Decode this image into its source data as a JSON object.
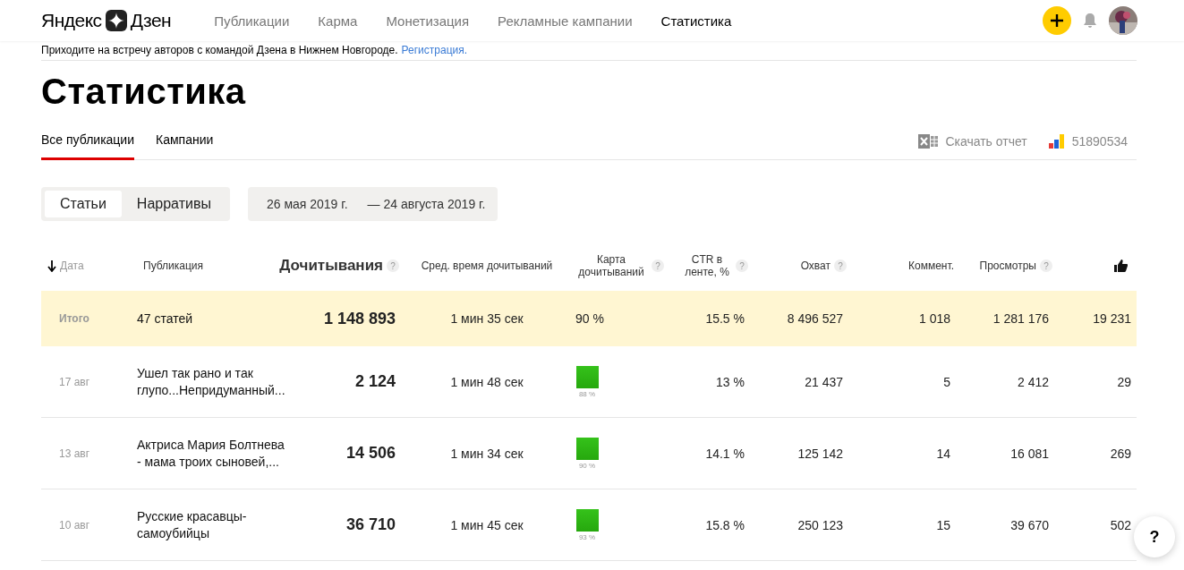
{
  "header": {
    "logo_left": "Яндекс",
    "logo_right": "Дзен",
    "nav": [
      {
        "label": "Публикации",
        "selected": false
      },
      {
        "label": "Карма",
        "selected": false
      },
      {
        "label": "Монетизация",
        "selected": false
      },
      {
        "label": "Рекламные кампании",
        "selected": false
      },
      {
        "label": "Статистика",
        "selected": true
      }
    ]
  },
  "banner": {
    "text": "Приходите на встречу авторов с командой Дзена в Нижнем Новгороде.",
    "link": "Регистрация."
  },
  "title": "Статистика",
  "tabs": [
    {
      "label": "Все публикации",
      "selected": true
    },
    {
      "label": "Кампании",
      "selected": false
    }
  ],
  "download": "Скачать отчет",
  "counter": "51890534",
  "segments": [
    {
      "label": "Статьи",
      "selected": true
    },
    {
      "label": "Нарративы",
      "selected": false
    }
  ],
  "date_range": {
    "from": "26 мая 2019 г.",
    "separator": "—",
    "to": "24 августа 2019 г."
  },
  "table": {
    "columns": [
      {
        "label": "Дата",
        "kind": "sorted"
      },
      {
        "label": "Публикация",
        "kind": "plain"
      },
      {
        "label": "Дочитывания",
        "kind": "large",
        "help": "?"
      },
      {
        "label": "Сред. время дочитываний",
        "kind": "plain"
      },
      {
        "label": "Карта дочитываний",
        "kind": "plain",
        "help": "?"
      },
      {
        "label": "CTR в ленте, %",
        "kind": "plain",
        "help": "?"
      },
      {
        "label": "Охват",
        "kind": "plain",
        "help": "?"
      },
      {
        "label": "Коммент.",
        "kind": "plain"
      },
      {
        "label": "Просмотры",
        "kind": "plain",
        "help": "?"
      },
      {
        "kind": "likes"
      }
    ],
    "total": {
      "label": "Итого",
      "publication": "47 статей",
      "reads": "1 148 893",
      "avg_time": "1 мин 35 сек",
      "map": "90 %",
      "ctr": "15.5 %",
      "reach": "8 496 527",
      "comments": "1 018",
      "views": "1 281 176",
      "likes": "19 231"
    },
    "rows": [
      {
        "date": "17 авг",
        "publication": "Ушел так рано и так глупо...Непридуманный...",
        "reads": "2 124",
        "avg_time": "1 мин 48 сек",
        "map": "88 %",
        "ctr": "13 %",
        "reach": "21 437",
        "comments": "5",
        "views": "2 412",
        "likes": "29"
      },
      {
        "date": "13 авг",
        "publication": "Актриса Мария Болтнева - мама троих сыновей,...",
        "reads": "14 506",
        "avg_time": "1 мин 34 сек",
        "map": "90 %",
        "ctr": "14.1 %",
        "reach": "125 142",
        "comments": "14",
        "views": "16 081",
        "likes": "269"
      },
      {
        "date": "10 авг",
        "publication": "Русские красавцы-самоубийцы",
        "reads": "36 710",
        "avg_time": "1 мин 45 сек",
        "map": "93 %",
        "ctr": "15.8 %",
        "reach": "250 123",
        "comments": "15",
        "views": "39 670",
        "likes": "502"
      }
    ]
  },
  "help_button": "?"
}
